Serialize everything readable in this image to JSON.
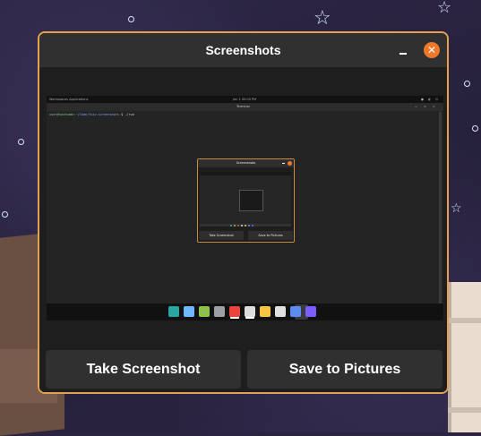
{
  "window": {
    "title": "Screenshots",
    "minimize_label": "–",
    "close_label": "✕"
  },
  "preview": {
    "top_bar_left": "Workspaces   Applications",
    "top_bar_clock": "Jan 1 00:00 PM",
    "top_bar_right": "● ◐ ⏻",
    "terminal_title": "Terminal",
    "terminal_icons": "▫ ≡ ✕",
    "prompt_user": "user@hostname",
    "prompt_path": ":~/Code/fuzz-screenshots",
    "prompt_cmd": "$ ./run",
    "mini_title": "Screenshots",
    "mini_take": "Take Screenshot",
    "mini_save": "Save to Pictures",
    "dock_colors": [
      "#2aa5a0",
      "#6fb7ff",
      "#8bc34a",
      "#9aa0a6",
      "#e8453c",
      "#dddddd",
      "#f6c343",
      "#e0e0e0",
      "#5b8def",
      "#7b5cff"
    ]
  },
  "actions": {
    "take_label": "Take Screenshot",
    "save_label": "Save to Pictures"
  }
}
